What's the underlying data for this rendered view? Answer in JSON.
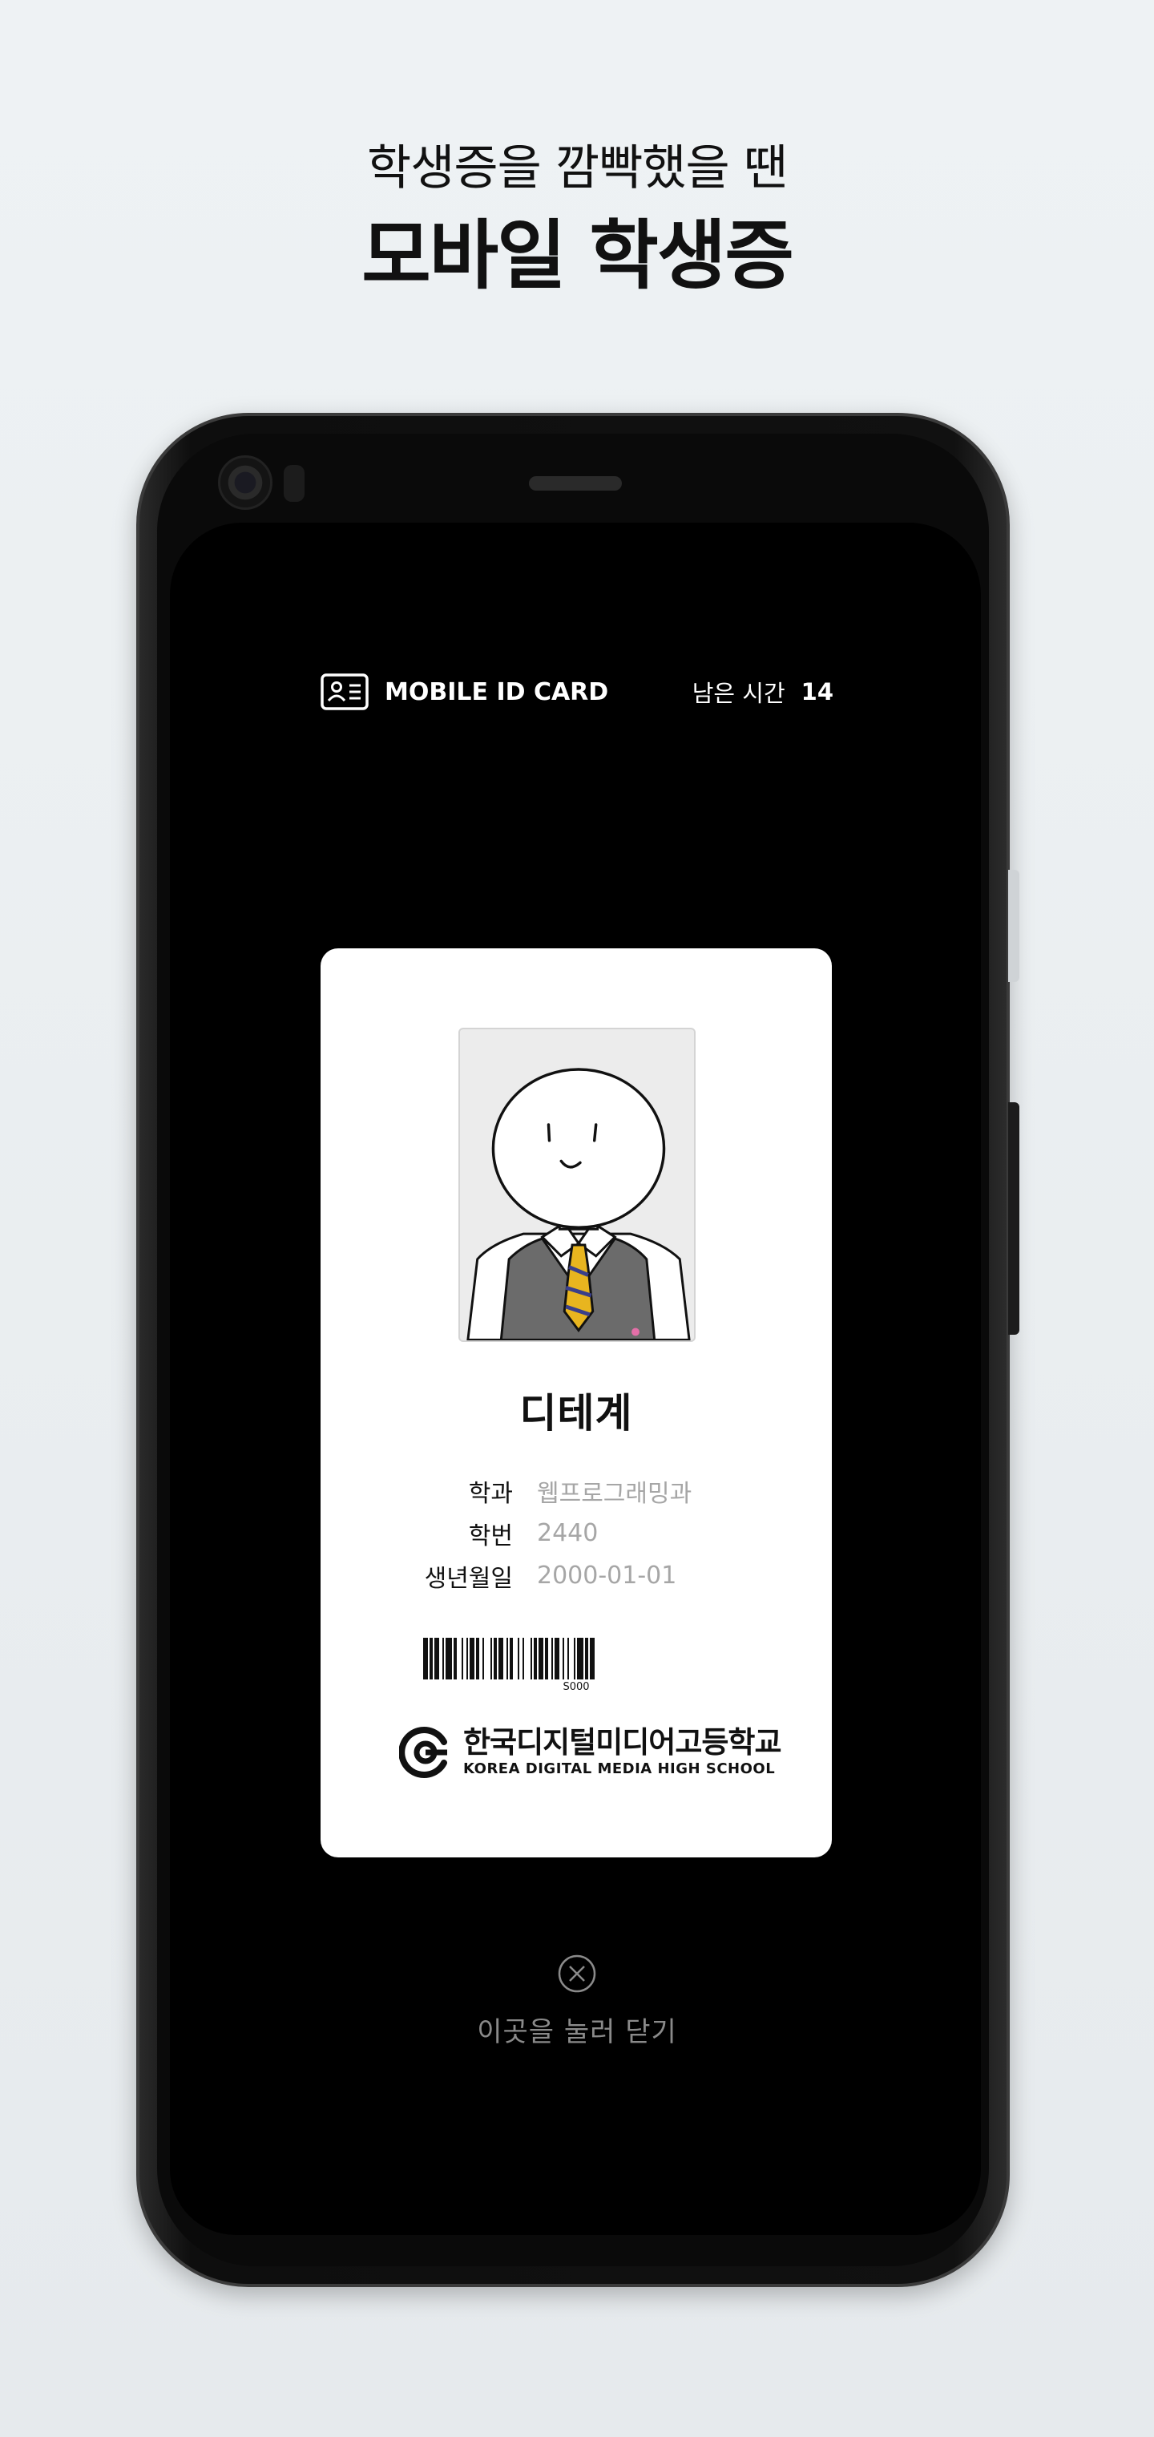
{
  "promo": {
    "subtitle": "학생증을 깜빡했을 땐",
    "title": "모바일 학생증"
  },
  "header": {
    "card_icon": "id-card-icon",
    "label": "MOBILE ID CARD",
    "timer_label": "남은 시간",
    "timer_value": "14"
  },
  "card": {
    "photo": "student-photo-illustration",
    "name": "디테계",
    "fields": [
      {
        "key": "학과",
        "value": "웹프로그래밍과"
      },
      {
        "key": "학번",
        "value": "2440"
      },
      {
        "key": "생년월일",
        "value": "2000-01-01"
      }
    ],
    "barcode_number": "S000",
    "school_name_ko": "한국디지털미디어고등학교",
    "school_name_en": "KOREA DIGITAL MEDIA HIGH SCHOOL",
    "school_logo": "school-logo-icon"
  },
  "close": {
    "icon": "close-circle-icon",
    "label": "이곳을 눌러 닫기"
  },
  "colors": {
    "screen_background": "#000000",
    "card_background": "#ffffff",
    "value_text": "#a6a6a6",
    "close_text": "#8a8a8a"
  }
}
